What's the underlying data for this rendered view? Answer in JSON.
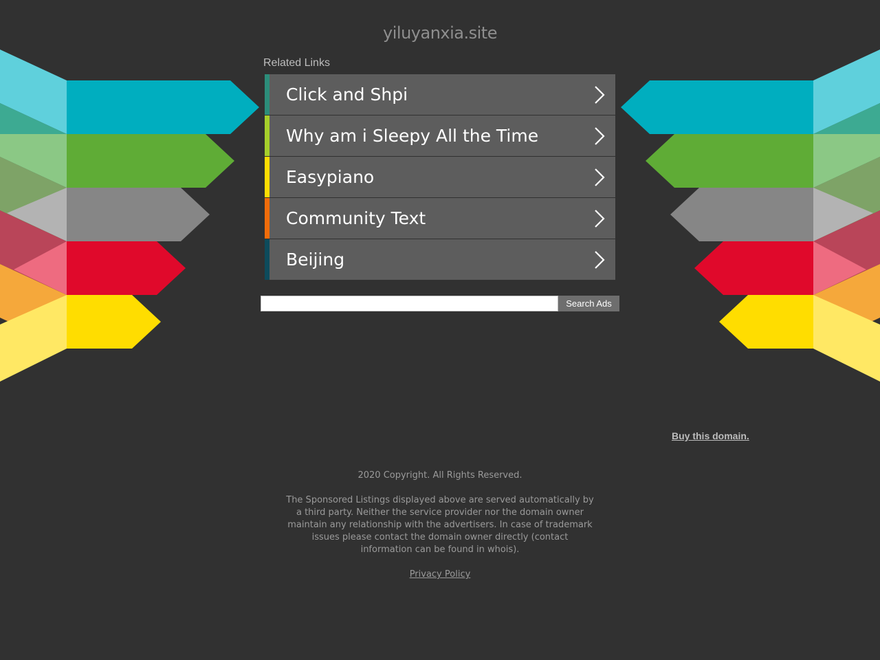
{
  "site": {
    "domain": "yiluyanxia.site"
  },
  "related": {
    "title": "Related Links",
    "links": [
      {
        "label": "Click and Shpi",
        "accent": "#2c8d7a"
      },
      {
        "label": "Why am i Sleepy All the Time",
        "accent": "#a6cf2b"
      },
      {
        "label": "Easypiano",
        "accent": "#ffdd00"
      },
      {
        "label": "Community Text",
        "accent": "#f06c0a"
      },
      {
        "label": "Beijing",
        "accent": "#0d4b5c"
      }
    ]
  },
  "search": {
    "button_label": "Search Ads",
    "placeholder": ""
  },
  "buy_domain": "Buy this domain.",
  "footer": {
    "copyright": "2020 Copyright. All Rights Reserved.",
    "disclaimer": "The Sponsored Listings displayed above are served automatically by a third party. Neither the service provider nor the domain owner maintain any relationship with the advertisers. In case of trademark issues please contact the domain owner directly (contact information can be found in whois).",
    "privacy": "Privacy Policy"
  },
  "decoration": {
    "stripe_colors": [
      "#00aebf",
      "#5fac36",
      "#868686",
      "#e0092b",
      "#ffdd00"
    ],
    "light_colors": [
      "#5fd0dc",
      "#9fcf82",
      "#b3b3b3",
      "#ee6b80",
      "#ffe864"
    ]
  }
}
